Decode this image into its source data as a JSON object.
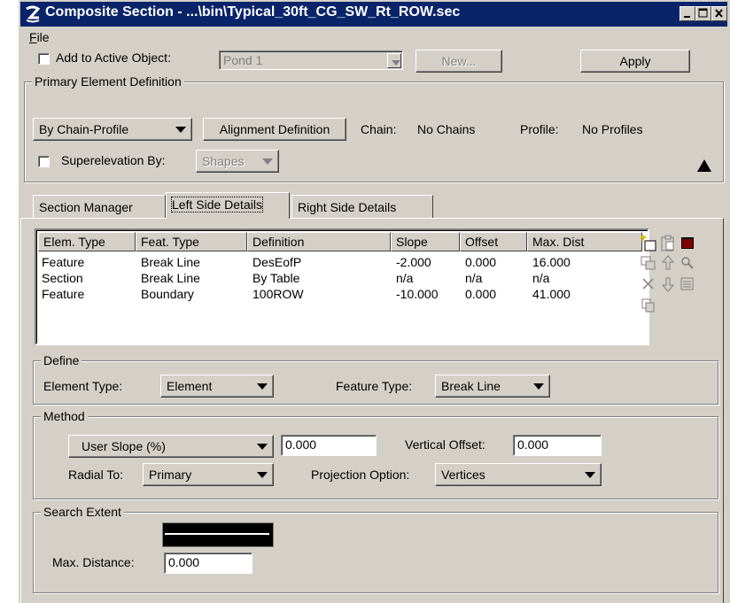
{
  "window": {
    "title": "Composite Section - ...\\bin\\Typical_30ft_CG_SW_Rt_ROW.sec"
  },
  "menu": {
    "file_label": "File",
    "file_mnemonic": "F",
    "file_rest": "ile"
  },
  "top": {
    "add_to_active_label": "Add to Active Object:",
    "active_object_value": "Pond 1",
    "new_label": "New...",
    "apply_label": "Apply"
  },
  "primary": {
    "group_title": "Primary Element Definition",
    "by_label": "By Chain-Profile",
    "alignment_label": "Alignment Definition",
    "chain_label": "Chain:",
    "chain_value": "No Chains",
    "profile_label": "Profile:",
    "profile_value": "No Profiles",
    "superelevation_label": "Superelevation By:",
    "superelevation_value": "Shapes"
  },
  "tabs": [
    {
      "label": "Section Manager"
    },
    {
      "label": "Left Side Details"
    },
    {
      "label": "Right Side Details"
    }
  ],
  "table": {
    "headers": [
      "Elem. Type",
      "Feat. Type",
      "Definition",
      "Slope",
      "Offset",
      "Max. Dist"
    ],
    "rows": [
      [
        "Feature",
        "Break Line",
        "DesEofP",
        "-2.000",
        "0.000",
        "16.000"
      ],
      [
        "Section",
        "Break Line",
        "By Table",
        "n/a",
        "n/a",
        "n/a"
      ],
      [
        "Feature",
        "Boundary",
        "100ROW",
        "-10.000",
        "0.000",
        "41.000"
      ]
    ]
  },
  "define": {
    "group_title": "Define",
    "element_type_label": "Element Type:",
    "element_type_value": "Element",
    "feature_type_label": "Feature Type:",
    "feature_type_value": "Break Line"
  },
  "method": {
    "group_title": "Method",
    "slope_mode_value": "User Slope (%)",
    "slope_value": "0.000",
    "vertical_offset_label": "Vertical Offset:",
    "vertical_offset_value": "0.000",
    "radial_to_label": "Radial To:",
    "radial_to_value": "Primary",
    "projection_label": "Projection Option:",
    "projection_value": "Vertices"
  },
  "search": {
    "group_title": "Search Extent",
    "max_distance_label": "Max. Distance:",
    "max_distance_value": "0.000"
  },
  "colors": {
    "titlebar": "#0a246a",
    "face": "#d4d0c8"
  }
}
